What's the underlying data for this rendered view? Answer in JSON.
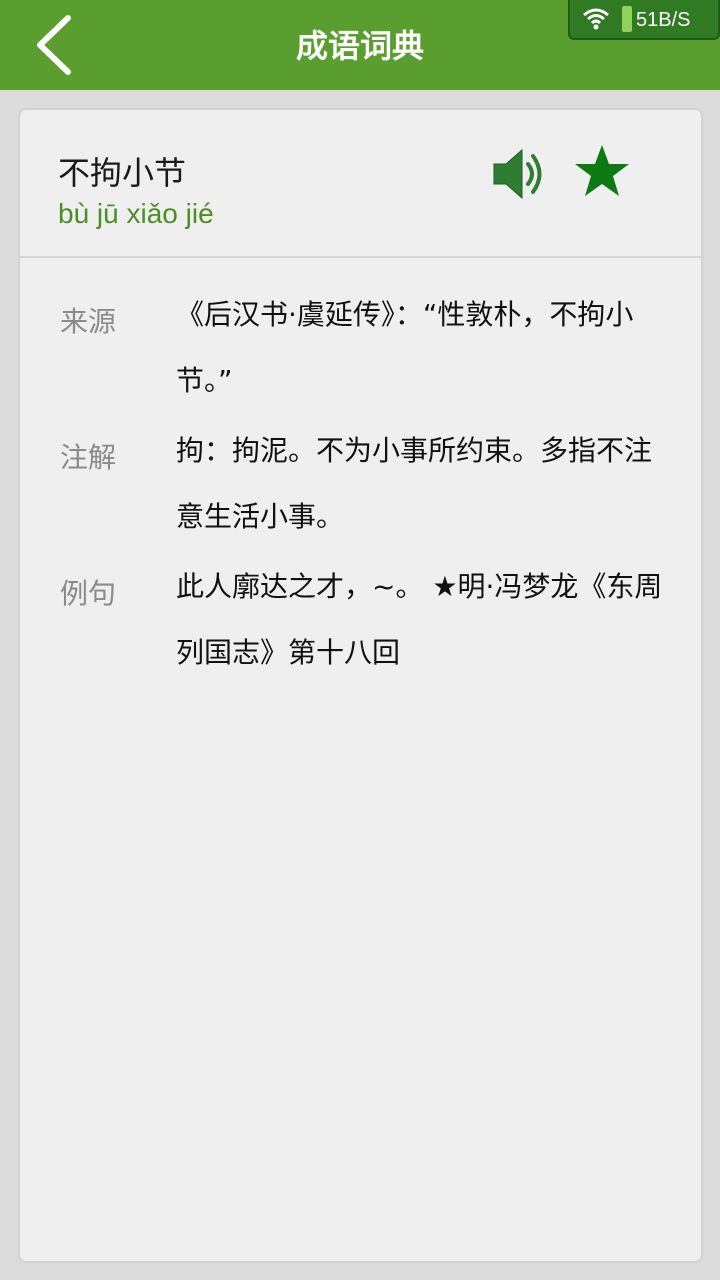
{
  "header": {
    "title": "成语词典",
    "back_icon": "chevron-left-icon",
    "background": "#5a9e2f"
  },
  "status": {
    "wifi_icon": "wifi-icon",
    "net_speed": "51B/S"
  },
  "idiom": {
    "word": "不拘小节",
    "pinyin": "bù jū xiǎo jié",
    "speaker_icon": "speaker-icon",
    "favorite_icon": "star-icon",
    "accent_color": "#0e7a14"
  },
  "details": [
    {
      "label": "来源",
      "text": "《后汉书·虞延传》：“性敦朴，不拘小节。”"
    },
    {
      "label": "注解",
      "text": "拘：拘泥。不为小事所约束。多指不注意生活小事。"
    },
    {
      "label": "例句",
      "text": "此人廓达之才，~。 ★明·冯梦龙《东周列国志》第十八回"
    }
  ]
}
